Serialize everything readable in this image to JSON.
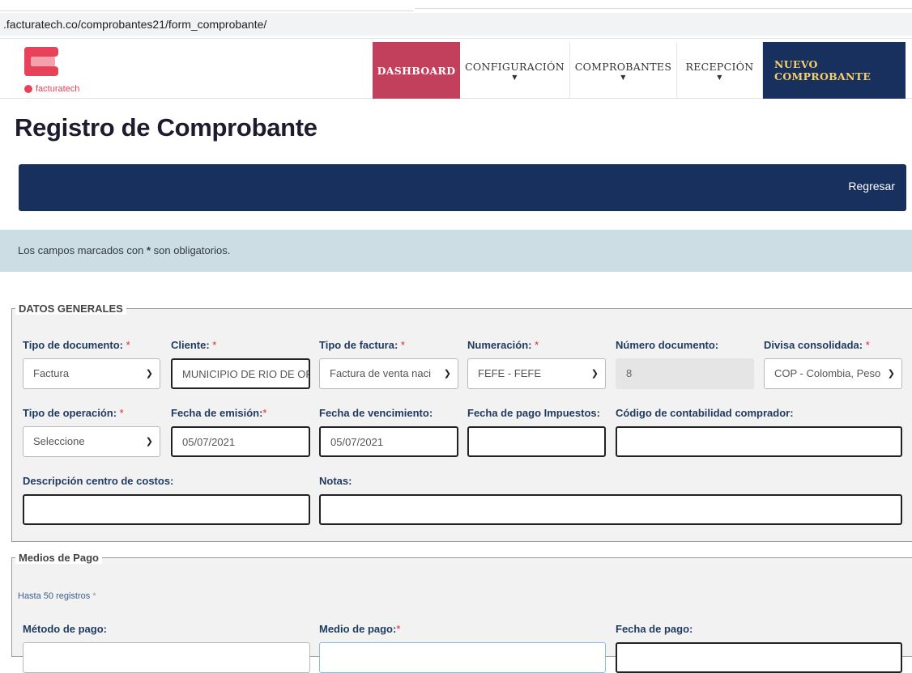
{
  "browser": {
    "url": ".facturatech.co/comprobantes21/form_comprobante/"
  },
  "brand": {
    "name": "facturatech",
    "colors": {
      "primary": "#e8415a",
      "navy": "#17305e",
      "gold": "#f6cf6a",
      "dashboard": "#c2405c",
      "info": "#ccdde4"
    }
  },
  "nav": {
    "dashboard": "DASHBOARD",
    "configuracion": "CONFIGURACIÓN",
    "comprobantes": "COMPROBANTES",
    "recepcion": "RECEPCIÓN",
    "nuevo": "NUEVO COMPROBANTE",
    "caret": "▼"
  },
  "page": {
    "title": "Registro de Comprobante",
    "back_button": "Regresar",
    "info_prefix": "Los campos marcados con ",
    "info_star": "*",
    "info_suffix": " son obligatorios."
  },
  "datos_generales": {
    "legend": "DATOS GENERALES",
    "tipo_documento": {
      "label": "Tipo de documento:",
      "req": " *",
      "value": "Factura"
    },
    "cliente": {
      "label": "Cliente:",
      "req": " *",
      "value": "MUNICIPIO DE RIO DE OF"
    },
    "tipo_factura": {
      "label": "Tipo de factura:",
      "req": " *",
      "value": "Factura de venta naci"
    },
    "numeracion": {
      "label": "Numeración:",
      "req": " *",
      "value": "FEFE - FEFE"
    },
    "numero_documento": {
      "label": "Número documento:",
      "value": "8"
    },
    "divisa": {
      "label": "Divisa consolidada:",
      "req": " *",
      "value": "COP - Colombia, Peso"
    },
    "tipo_operacion": {
      "label": "Tipo de operación:",
      "req": " *",
      "value": "Seleccione"
    },
    "fecha_emision": {
      "label": "Fecha de emisión:",
      "req": "*",
      "value": "05/07/2021"
    },
    "fecha_vencimiento": {
      "label": "Fecha de vencimiento:",
      "value": "05/07/2021"
    },
    "fecha_pago_impuestos": {
      "label": "Fecha de pago Impuestos:",
      "value": ""
    },
    "codigo_contabilidad": {
      "label": "Código de contabilidad comprador:",
      "value": ""
    },
    "descripcion_centro": {
      "label": "Descripción centro de costos:",
      "value": ""
    },
    "notas": {
      "label": "Notas:",
      "value": ""
    }
  },
  "medios_pago": {
    "legend": "Medios de Pago",
    "hint": "Hasta 50 registros",
    "hint_req": " *",
    "metodo_pago": {
      "label": "Método de pago:"
    },
    "medio_pago": {
      "label": "Medio de pago:",
      "req": "*"
    },
    "fecha_pago": {
      "label": "Fecha de pago:"
    }
  }
}
